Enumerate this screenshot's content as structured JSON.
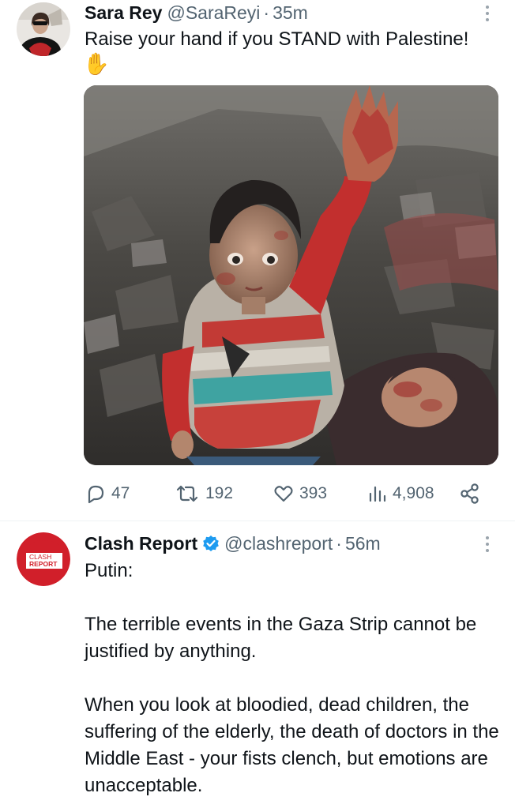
{
  "tweets": [
    {
      "author": {
        "name": "Sara Rey",
        "handle": "@SaraReyi",
        "time": "35m"
      },
      "text": "Raise your hand if you STAND with Palestine!",
      "emoji": "✋",
      "stats": {
        "replies": "47",
        "retweets": "192",
        "likes": "393",
        "views": "4,908"
      }
    },
    {
      "author": {
        "name": "Clash Report",
        "handle": "@clashreport",
        "time": "56m",
        "verified": true,
        "avatar_text": [
          "CLASH",
          "REPORT"
        ]
      },
      "paragraphs": [
        "Putin:",
        "The terrible events in the Gaza Strip cannot be justified by anything.",
        "When you look at bloodied, dead children, the suffering of the elderly, the death of doctors in the Middle East - your fists clench, but emotions are unacceptable."
      ]
    }
  ],
  "separator": "·",
  "colors": {
    "text": "#0f1419",
    "secondary": "#536471",
    "verified": "#1d9bf0",
    "clash_red": "#d11f2a"
  },
  "icons": {
    "reply": "reply-icon",
    "retweet": "retweet-icon",
    "like": "heart-icon",
    "views": "views-icon",
    "share": "share-icon",
    "more": "more-icon"
  }
}
